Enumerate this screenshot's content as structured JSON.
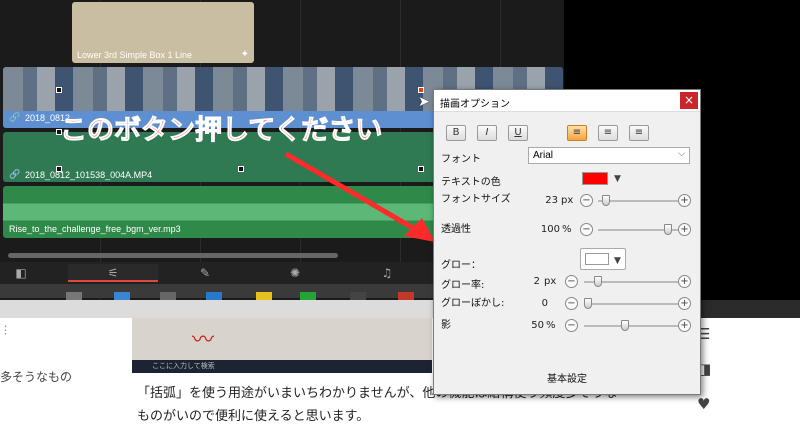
{
  "timeline": {
    "title_clip_label": "Lower 3rd Simple Box 1 Line",
    "video_clip_label": "2018_0812_101538_004A.MP4",
    "video_clip_label_short": "2018_0812_",
    "green_clip_label": "2018_0812_101538_004A.MP4",
    "audio_clip_label": "Rise_to_the_challenge_free_bgm_ver.mp3"
  },
  "annotation": {
    "text": "このボタン押してください",
    "color": "#ff2a2a"
  },
  "dialog": {
    "title": "描画オプション",
    "close_label": "×",
    "format_buttons": [
      "B",
      "I",
      "U"
    ],
    "align_buttons": [
      "≡",
      "≡",
      "≡"
    ],
    "font_label": "フォント",
    "font_value": "Arial",
    "text_color_label": "テキストの色",
    "text_color": "#ff0000",
    "font_size_label": "フォントサイズ",
    "font_size_value": "23",
    "font_size_unit": "px",
    "opacity_label": "透過性",
    "opacity_value": "100",
    "opacity_unit": "%",
    "glow_label": "グロー：",
    "glow_rate_label": "グロー率:",
    "glow_rate_value": "2",
    "glow_rate_unit": "px",
    "glow_blur_label": "グローぼかし:",
    "glow_blur_value": "0",
    "shadow_label": "影",
    "shadow_value": "50",
    "shadow_unit": "%",
    "minus": "−",
    "plus": "+",
    "basic_settings_label": "基本設定"
  },
  "article": {
    "left_snippet": "多そうなもの",
    "paragraph_line1": "「括弧」を使う用途がいまいちわかりませんが、他の機能は結構使う頻度多そうな",
    "paragraph_line2": "ものがいので便利に使えると思います。",
    "thumb_taskbar_text": "ここに入力して検索"
  },
  "colors": {
    "accent_red": "#c8262a",
    "video_blue": "#5d8fd1",
    "green_track": "#2f7a52"
  }
}
